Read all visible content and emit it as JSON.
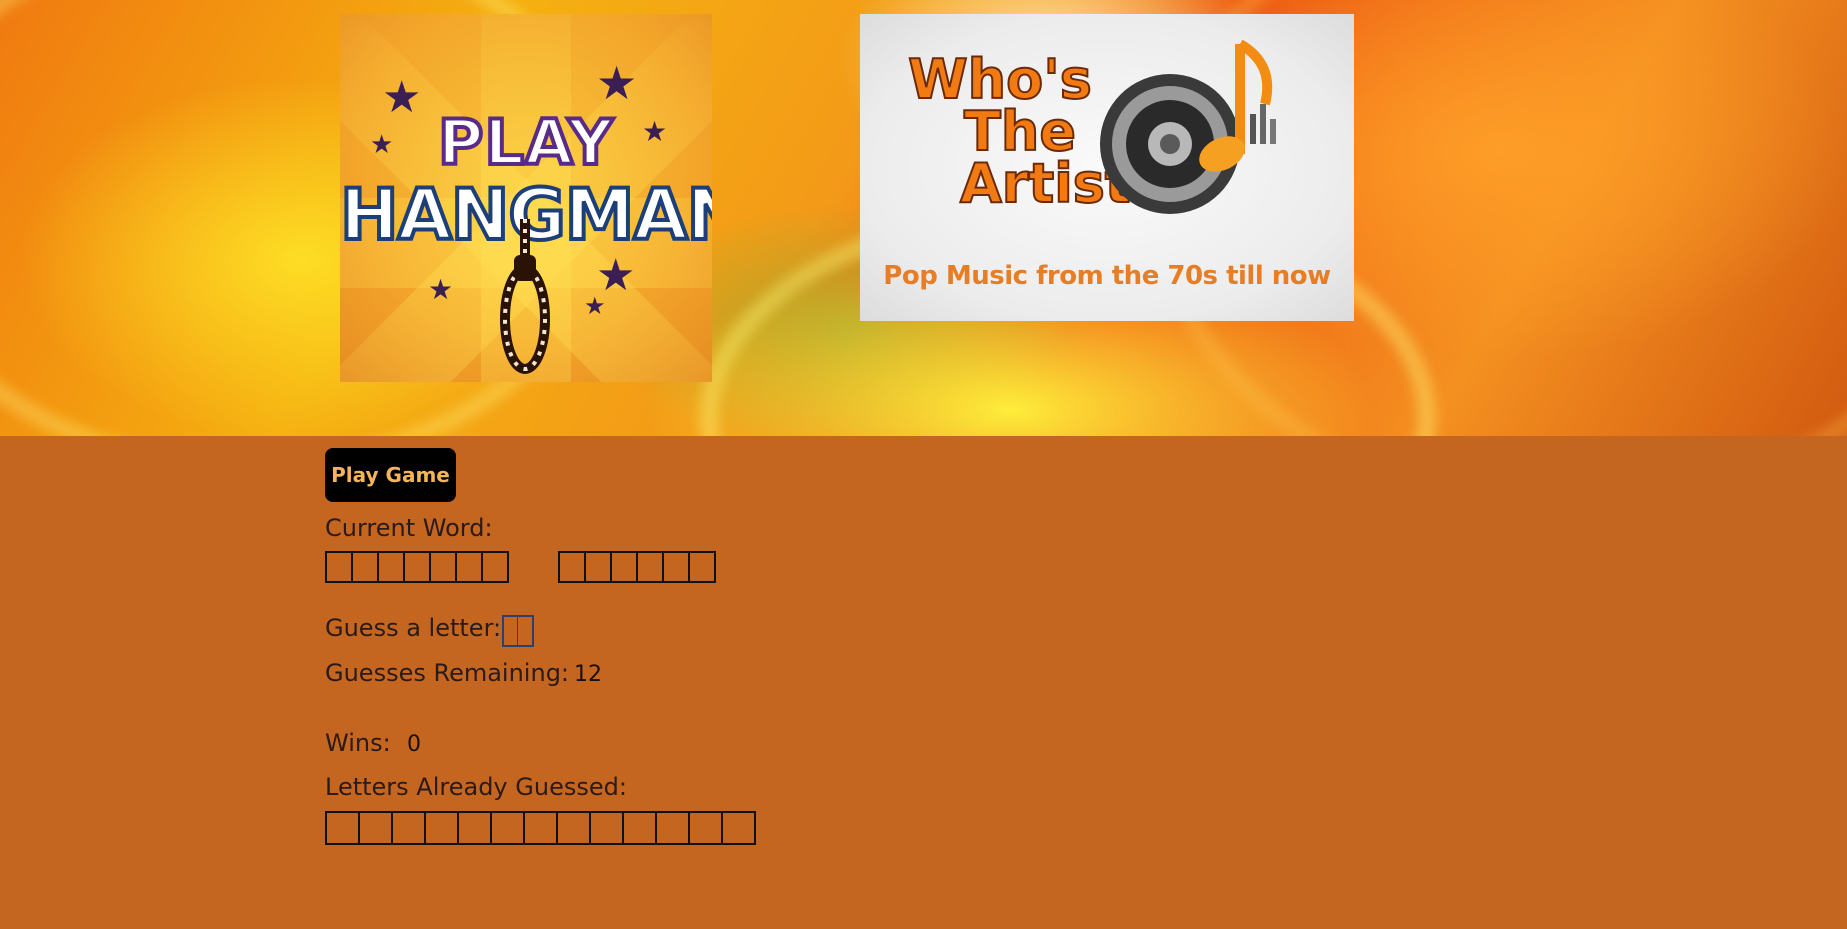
{
  "hero": {
    "hangman_logo": {
      "line1": "PLAY",
      "line2": "HANGMAN"
    },
    "artist_logo": {
      "title_line1": "Who's",
      "title_line2": "The",
      "title_line3": "Artist",
      "subtitle": "Pop Music from the 70s till now"
    }
  },
  "game": {
    "play_button_label": "Play Game",
    "current_word_label": "Current Word:",
    "current_word": {
      "word1_blank_count": 7,
      "word2_blank_count": 6
    },
    "guess_label": "Guess a letter:",
    "guess_input_value": "",
    "guesses_remaining_label": "Guesses Remaining:",
    "guesses_remaining_value": "12",
    "wins_label": "Wins:",
    "wins_value": "0",
    "letters_guessed_label": "Letters Already Guessed:",
    "letters_guessed_slot_count": 13
  },
  "colors": {
    "page_background": "#c46620",
    "button_background": "#000000",
    "button_text": "#f4b557",
    "label_text": "#2a1a1a"
  }
}
